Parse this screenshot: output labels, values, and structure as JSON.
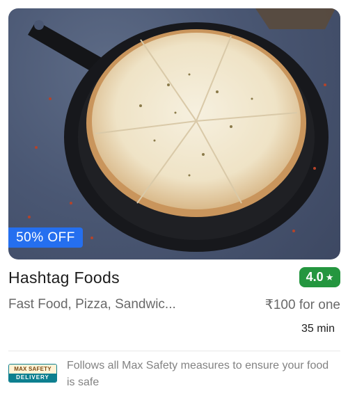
{
  "restaurant": {
    "name": "Hashtag Foods",
    "rating": "4.0",
    "rating_icon": "star-icon",
    "cuisines": "Fast Food, Pizza, Sandwic...",
    "price_for_one": "₹100 for one",
    "delivery_time": "35 min",
    "image_alt": "pizza-photo"
  },
  "offer": {
    "label": "50% OFF"
  },
  "safety": {
    "logo_top": "MAX SAFETY",
    "logo_bottom": "DELIVERY",
    "text": "Follows all Max Safety measures to ensure your food is safe"
  },
  "colors": {
    "offer_badge": "#256fef",
    "rating_badge": "#24963f",
    "safety_teal": "#0d7f8f"
  }
}
